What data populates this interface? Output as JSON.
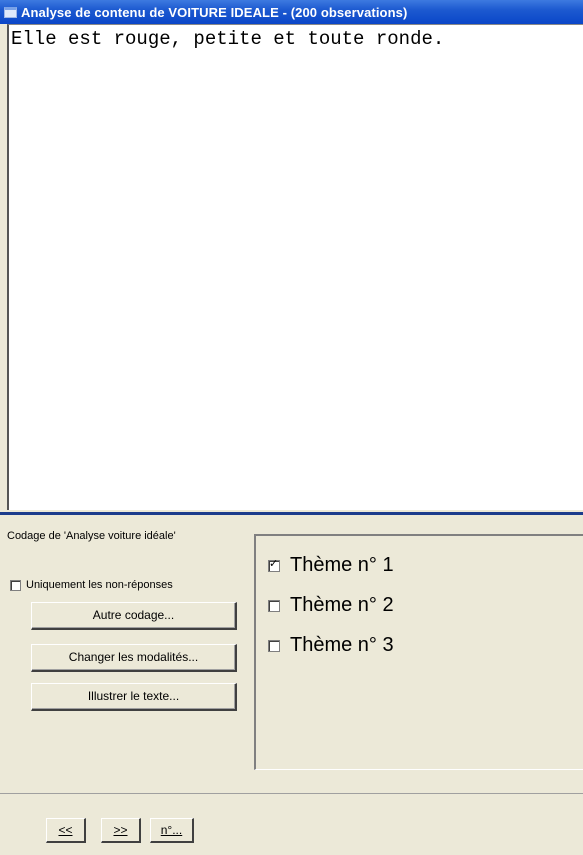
{
  "window": {
    "title": "Analyse de contenu de VOITURE IDEALE -  (200 observations)"
  },
  "text_panel": {
    "content": "Elle est rouge, petite et toute ronde."
  },
  "coding": {
    "label": "Codage de 'Analyse voiture idéale'",
    "only_nonresponses_label": "Uniquement les non-réponses",
    "only_nonresponses_checked": false,
    "buttons": {
      "other_coding": "Autre codage...",
      "change_modalities": "Changer les modalités...",
      "illustrate_text": "Illustrer le texte..."
    },
    "themes": [
      {
        "label": "Thème n° 1",
        "checked": true
      },
      {
        "label": "Thème n° 2",
        "checked": false
      },
      {
        "label": "Thème n° 3",
        "checked": false
      }
    ]
  },
  "navigation": {
    "prev": "<<",
    "next": ">>",
    "number": "n°..."
  }
}
